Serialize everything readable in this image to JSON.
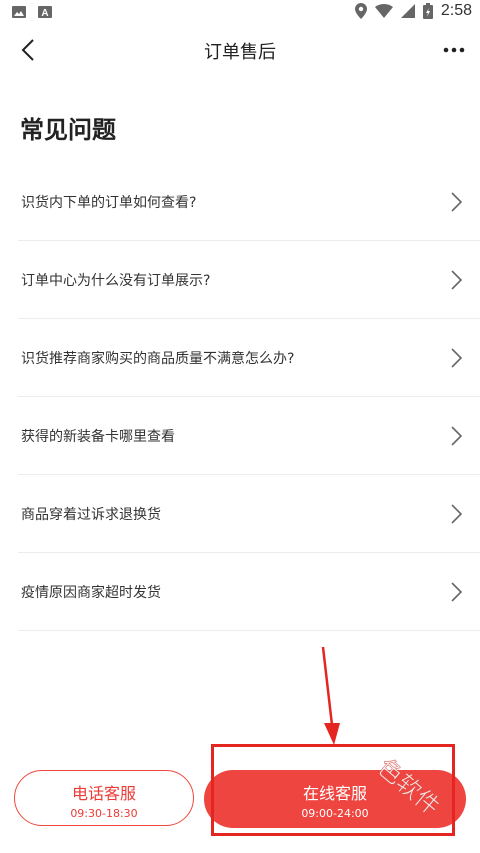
{
  "status_bar": {
    "time": "2:58",
    "icons": [
      "image-icon",
      "app-a-icon",
      "location-icon",
      "wifi-icon",
      "signal-icon",
      "battery-icon"
    ]
  },
  "nav": {
    "title": "订单售后",
    "back_icon": "chevron-left-icon",
    "more_icon": "more-dots-icon"
  },
  "section_title": "常见问题",
  "faq": [
    {
      "text": "识货内下单的订单如何查看?"
    },
    {
      "text": "订单中心为什么没有订单展示?"
    },
    {
      "text": "识货推荐商家购买的商品质量不满意怎么办?"
    },
    {
      "text": "获得的新装备卡哪里查看"
    },
    {
      "text": "商品穿着过诉求退换货"
    },
    {
      "text": "疫情原因商家超时发货"
    }
  ],
  "buttons": {
    "phone": {
      "label": "电话客服",
      "hours": "09:30-18:30"
    },
    "online": {
      "label": "在线客服",
      "hours": "09:00-24:00"
    }
  },
  "colors": {
    "accent": "#ef4540",
    "annotation": "#e52620"
  }
}
